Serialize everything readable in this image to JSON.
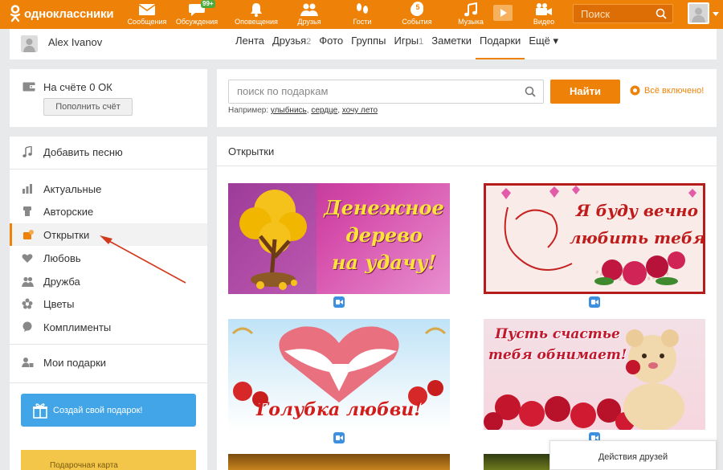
{
  "brand": {
    "name": "одноклассники",
    "accent": "#ee8208"
  },
  "topnav": [
    {
      "label": "Сообщения",
      "icon": "envelope-icon",
      "badge": ""
    },
    {
      "label": "Обсуждения",
      "icon": "chat-bubble-icon",
      "badge": "99+"
    },
    {
      "label": "Оповещения",
      "icon": "bell-icon",
      "badge": ""
    },
    {
      "label": "Друзья",
      "icon": "friends-icon",
      "badge": ""
    },
    {
      "label": "Гости",
      "icon": "footprints-icon",
      "badge": ""
    },
    {
      "label": "События",
      "icon": "events-icon",
      "badge": "5"
    },
    {
      "label": "Музыка",
      "icon": "music-note-icon",
      "badge": ""
    },
    {
      "label": "Видео",
      "icon": "video-camera-icon",
      "badge": ""
    }
  ],
  "top_search": {
    "placeholder": "Поиск"
  },
  "user": {
    "name": "Alex Ivanov"
  },
  "tabs": [
    {
      "label": "Лента",
      "count": ""
    },
    {
      "label": "Друзья",
      "count": "2"
    },
    {
      "label": "Фото",
      "count": ""
    },
    {
      "label": "Группы",
      "count": ""
    },
    {
      "label": "Игры",
      "count": "1"
    },
    {
      "label": "Заметки",
      "count": ""
    },
    {
      "label": "Подарки",
      "count": "",
      "active": true
    },
    {
      "label": "Ещё ▾",
      "count": ""
    }
  ],
  "balance": {
    "text": "На счёте 0 ОК",
    "button": "Пополнить счёт"
  },
  "gift_search": {
    "placeholder": "поиск по подаркам",
    "button": "Найти",
    "all_included": "Всё включено!",
    "examples_prefix": "Например:",
    "examples": [
      "улыбнись",
      "сердце",
      "хочу лето"
    ]
  },
  "sidebar": {
    "add_song": "Добавить песню",
    "categories": [
      {
        "label": "Актуальные",
        "icon": "trending-icon"
      },
      {
        "label": "Авторские",
        "icon": "author-icon"
      },
      {
        "label": "Открытки",
        "icon": "postcard-icon",
        "active": true
      },
      {
        "label": "Любовь",
        "icon": "heart-icon"
      },
      {
        "label": "Дружба",
        "icon": "friendship-icon"
      },
      {
        "label": "Цветы",
        "icon": "flower-icon"
      },
      {
        "label": "Комплименты",
        "icon": "compliment-icon"
      }
    ],
    "my_gifts": "Мои подарки",
    "create_gift": "Создай свой подарок!",
    "promo_text": "Подарочная карта"
  },
  "cards_section": {
    "title": "Открытки",
    "cards": [
      {
        "text": [
          "Денежное",
          "дерево",
          "на удачу!"
        ]
      },
      {
        "text": [
          "Я буду вечно",
          "любить тебя!"
        ]
      },
      {
        "text": [
          "Голубка любви!"
        ]
      },
      {
        "text": [
          "Пусть счастье",
          "тебя обнимает!"
        ]
      }
    ]
  },
  "friends_panel": {
    "label": "Действия друзей"
  }
}
